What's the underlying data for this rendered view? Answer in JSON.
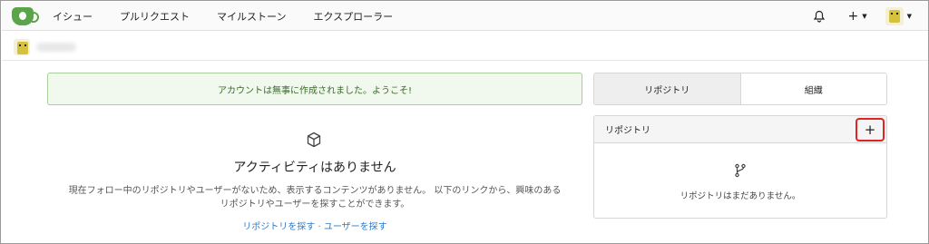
{
  "nav": {
    "items": [
      "イシュー",
      "プルリクエスト",
      "マイルストーン",
      "エクスプローラー"
    ],
    "plus_label": "+"
  },
  "flash": {
    "message": "アカウントは無事に作成されました。ようこそ!"
  },
  "feed": {
    "empty_title": "アクティビティはありません",
    "empty_desc_line1": "現在フォロー中のリポジトリやユーザーがないため、表示するコンテンツがありません。 以下のリンクから、興味のある",
    "empty_desc_line2": "リポジトリやユーザーを探すことができます。",
    "link_repos": "リポジトリを探す",
    "link_separator": " · ",
    "link_users": "ユーザーを探す"
  },
  "panel": {
    "tabs": [
      "リポジトリ",
      "組織"
    ],
    "repo_header": "リポジトリ",
    "add_label": "+",
    "repo_empty": "リポジトリはまだありません。"
  },
  "colors": {
    "brand": "#5aa54a",
    "link": "#2f7bc9",
    "flash_bg": "#f1f8ee",
    "highlight": "#e02424"
  },
  "icons": {
    "logo": "gitea-logo",
    "bell": "bell-icon",
    "cube": "cube-icon",
    "branch": "repo-fork-icon"
  }
}
